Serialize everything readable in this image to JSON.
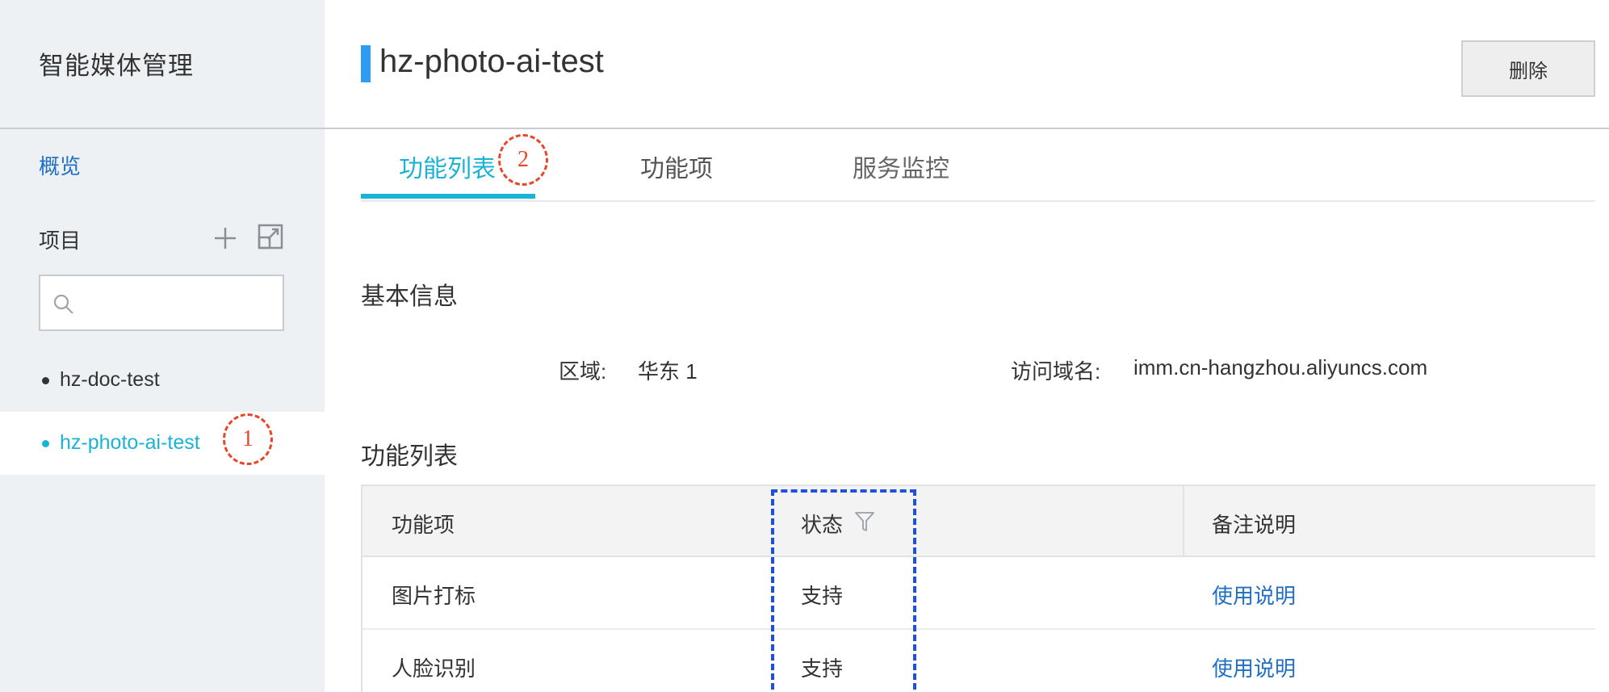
{
  "sidebar": {
    "title": "智能媒体管理",
    "overview": "概览",
    "project_label": "项目",
    "search": {
      "placeholder": ""
    },
    "items": [
      {
        "label": "hz-doc-test"
      },
      {
        "label": "hz-photo-ai-test"
      }
    ]
  },
  "markers": [
    "1",
    "2"
  ],
  "header": {
    "title": "hz-photo-ai-test",
    "delete_label": "删除"
  },
  "tabs": [
    {
      "label": "功能列表"
    },
    {
      "label": "功能项"
    },
    {
      "label": "服务监控"
    }
  ],
  "basic_info": {
    "title": "基本信息",
    "region_label": "区域:",
    "region_value": "华东 1",
    "domain_label": "访问域名:",
    "domain_value": "imm.cn-hangzhou.aliyuncs.com"
  },
  "feature_list": {
    "title": "功能列表",
    "columns": [
      "功能项",
      "状态",
      "备注说明"
    ],
    "rows": [
      {
        "feature": "图片打标",
        "status": "支持",
        "note": "使用说明"
      },
      {
        "feature": "人脸识别",
        "status": "支持",
        "note": "使用说明"
      }
    ]
  },
  "colors": {
    "accent": "#1ab3d6",
    "link": "#1f6fc4",
    "marker": "#e8462a",
    "highlight_box": "#1f4fe0"
  },
  "icons": [
    "plus-icon",
    "expand-icon",
    "search-icon",
    "filter-icon"
  ]
}
